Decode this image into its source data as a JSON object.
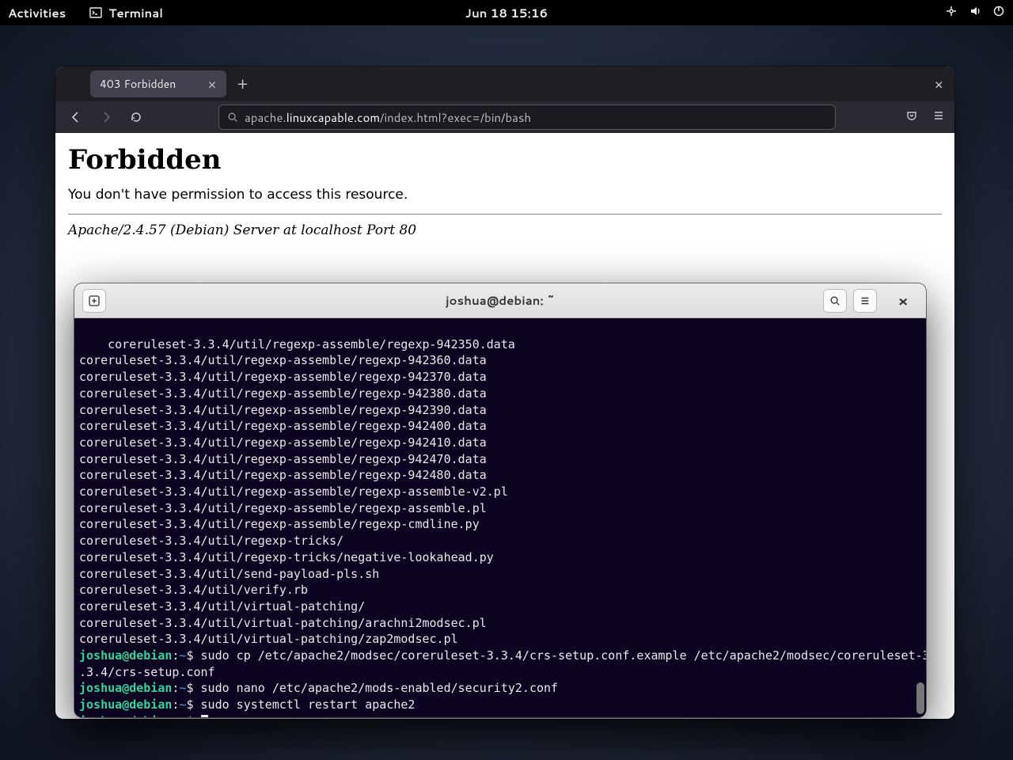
{
  "topbar": {
    "activities": "Activities",
    "terminal": "Terminal",
    "datetime": "Jun 18  15:16"
  },
  "browser": {
    "tab_title": "403 Forbidden",
    "url_pre": "apache.",
    "url_domain": "linuxcapable.com",
    "url_path": "/index.html?exec=/bin/bash",
    "page": {
      "heading": "Forbidden",
      "body": "You don't have permission to access this resource.",
      "signature": "Apache/2.4.57 (Debian) Server at localhost Port 80"
    }
  },
  "terminal": {
    "title": "joshua@debian: ~",
    "output_lines": [
      "coreruleset-3.3.4/util/regexp-assemble/regexp-942350.data",
      "coreruleset-3.3.4/util/regexp-assemble/regexp-942360.data",
      "coreruleset-3.3.4/util/regexp-assemble/regexp-942370.data",
      "coreruleset-3.3.4/util/regexp-assemble/regexp-942380.data",
      "coreruleset-3.3.4/util/regexp-assemble/regexp-942390.data",
      "coreruleset-3.3.4/util/regexp-assemble/regexp-942400.data",
      "coreruleset-3.3.4/util/regexp-assemble/regexp-942410.data",
      "coreruleset-3.3.4/util/regexp-assemble/regexp-942470.data",
      "coreruleset-3.3.4/util/regexp-assemble/regexp-942480.data",
      "coreruleset-3.3.4/util/regexp-assemble/regexp-assemble-v2.pl",
      "coreruleset-3.3.4/util/regexp-assemble/regexp-assemble.pl",
      "coreruleset-3.3.4/util/regexp-assemble/regexp-cmdline.py",
      "coreruleset-3.3.4/util/regexp-tricks/",
      "coreruleset-3.3.4/util/regexp-tricks/negative-lookahead.py",
      "coreruleset-3.3.4/util/send-payload-pls.sh",
      "coreruleset-3.3.4/util/verify.rb",
      "coreruleset-3.3.4/util/virtual-patching/",
      "coreruleset-3.3.4/util/virtual-patching/arachni2modsec.pl",
      "coreruleset-3.3.4/util/virtual-patching/zap2modsec.pl"
    ],
    "prompts": [
      {
        "user": "joshua",
        "host": "debian",
        "path": "~",
        "cmd": "sudo cp /etc/apache2/modsec/coreruleset-3.3.4/crs-setup.conf.example /etc/apache2/modsec/coreruleset-3.3.4/crs-setup.conf",
        "wrapped_prefix": ".3.4/crs-setup.conf"
      },
      {
        "user": "joshua",
        "host": "debian",
        "path": "~",
        "cmd": "sudo nano /etc/apache2/mods-enabled/security2.conf"
      },
      {
        "user": "joshua",
        "host": "debian",
        "path": "~",
        "cmd": "sudo systemctl restart apache2"
      },
      {
        "user": "joshua",
        "host": "debian",
        "path": "~",
        "cmd": ""
      }
    ]
  }
}
